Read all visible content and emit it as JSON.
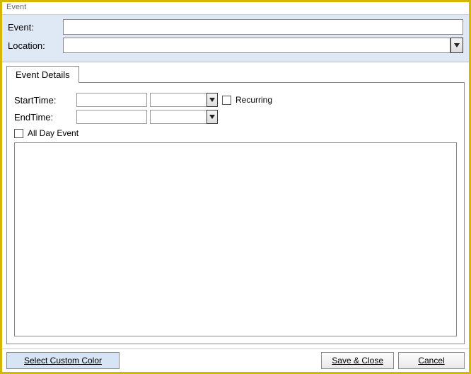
{
  "window": {
    "title": "Event"
  },
  "header": {
    "event_label": "Event:",
    "event_value": "",
    "location_label": "Location:",
    "location_value": ""
  },
  "tab": {
    "label": "Event Details"
  },
  "details": {
    "starttime_label": "StartTime:",
    "start_date": "",
    "start_time": "",
    "recurring_label": "Recurring",
    "recurring_checked": false,
    "endtime_label": "EndTime:",
    "end_date": "",
    "end_time": "",
    "allday_label": "All Day Event",
    "allday_checked": false,
    "notes": ""
  },
  "footer": {
    "color_btn": "Select Custom Color",
    "save_btn": "Save & Close",
    "cancel_btn": "Cancel"
  }
}
